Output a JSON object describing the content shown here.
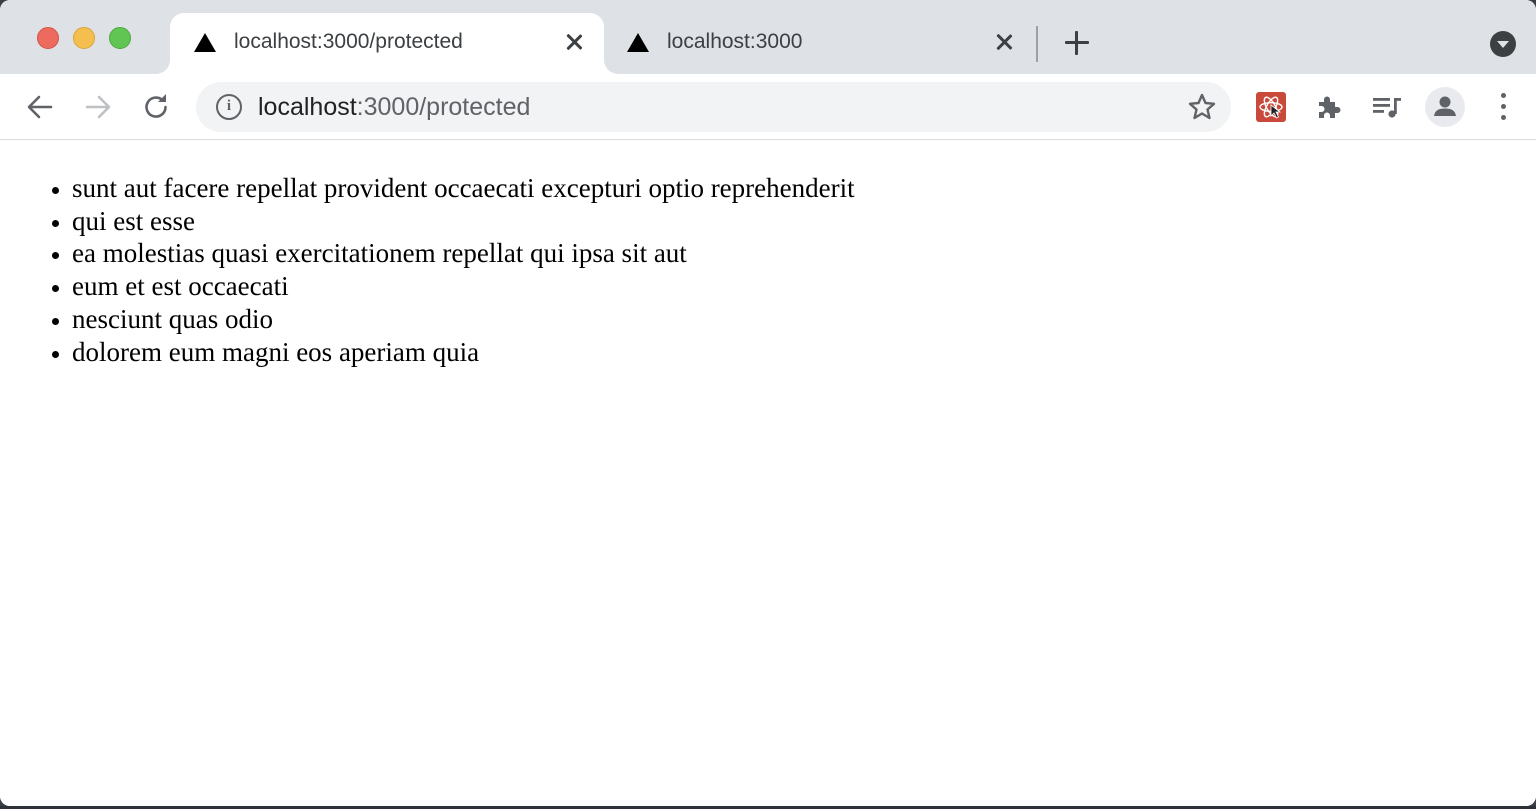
{
  "browser": {
    "tabs": [
      {
        "title": "localhost:3000/protected",
        "active": true,
        "favicon": "triangle-icon"
      },
      {
        "title": "localhost:3000",
        "active": false,
        "favicon": "triangle-icon"
      }
    ],
    "address_bar": {
      "host": "localhost",
      "path": ":3000/protected"
    },
    "extensions": [
      "react-devtools-icon",
      "puzzle-icon",
      "media-queue-icon"
    ],
    "colors": {
      "tabstrip": "#dee1e6",
      "icon": "#5f6368",
      "extension_accent": "#c94a3b"
    }
  },
  "page": {
    "posts": [
      "sunt aut facere repellat provident occaecati excepturi optio reprehenderit",
      "qui est esse",
      "ea molestias quasi exercitationem repellat qui ipsa sit aut",
      "eum et est occaecati",
      "nesciunt quas odio",
      "dolorem eum magni eos aperiam quia"
    ]
  }
}
